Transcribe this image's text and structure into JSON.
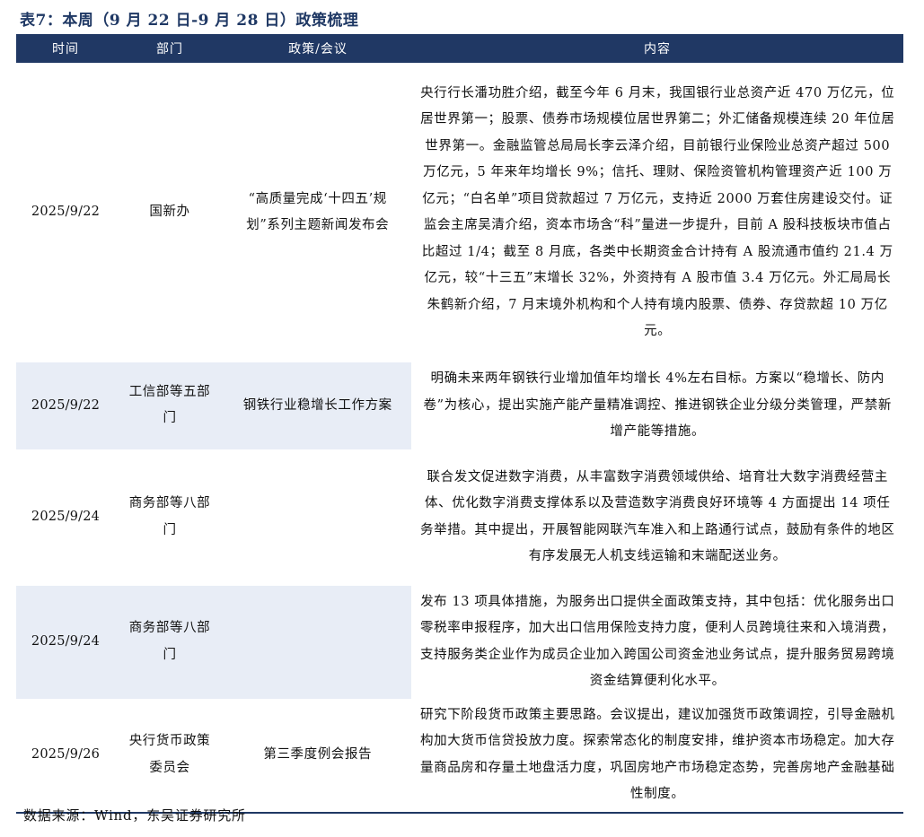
{
  "title": "表7：本周（9 月 22 日-9 月 28 日）政策梳理",
  "headers": {
    "time": "时间",
    "dept": "部门",
    "policy": "政策/会议",
    "content": "内容"
  },
  "rows": [
    {
      "date": "2025/9/22",
      "dept": "国新办",
      "policy": "“高质量完成‘十四五’规划”系列主题新闻发布会",
      "content": "央行行长潘功胜介绍，截至今年 6 月末，我国银行业总资产近 470 万亿元，位居世界第一；股票、债券市场规模位居世界第二；外汇储备规模连续 20 年位居世界第一。金融监管总局局长李云泽介绍，目前银行业保险业总资产超过 500 万亿元，5 年来年均增长 9%；信托、理财、保险资管机构管理资产近 100 万亿元；“白名单”项目贷款超过 7 万亿元，支持近 2000 万套住房建设交付。证监会主席吴清介绍，资本市场含“科”量进一步提升，目前 A 股科技板块市值占比超过 1/4；截至 8 月底，各类中长期资金合计持有 A 股流通市值约 21.4 万亿元，较“十三五”末增长 32%，外资持有 A 股市值 3.4 万亿元。外汇局局长朱鹤新介绍，7 月末境外机构和个人持有境内股票、债券、存贷款超 10 万亿元。"
    },
    {
      "date": "2025/9/22",
      "dept": "工信部等五部门",
      "policy": "钢铁行业稳增长工作方案",
      "content": "明确未来两年钢铁行业增加值年均增长 4%左右目标。方案以“稳增长、防内卷”为核心，提出实施产能产量精准调控、推进钢铁企业分级分类管理，严禁新增产能等措施。"
    },
    {
      "date": "2025/9/24",
      "dept": "商务部等八部门",
      "policy": "",
      "content": "联合发文促进数字消费，从丰富数字消费领域供给、培育壮大数字消费经营主体、优化数字消费支撑体系以及营造数字消费良好环境等 4 方面提出 14 项任务举措。其中提出，开展智能网联汽车准入和上路通行试点，鼓励有条件的地区有序发展无人机支线运输和末端配送业务。"
    },
    {
      "date": "2025/9/24",
      "dept": "商务部等八部门",
      "policy": "",
      "content": "发布 13 项具体措施，为服务出口提供全面政策支持，其中包括：优化服务出口零税率申报程序，加大出口信用保险支持力度，便利人员跨境往来和入境消费，支持服务类企业作为成员企业加入跨国公司资金池业务试点，提升服务贸易跨境资金结算便利化水平。"
    },
    {
      "date": "2025/9/26",
      "dept": "央行货币政策委员会",
      "policy": "第三季度例会报告",
      "content": "研究下阶段货币政策主要思路。会议提出，建议加强货币政策调控，引导金融机构加大货币信贷投放力度。探索常态化的制度安排，维护资本市场稳定。加大存量商品房和存量土地盘活力度，巩固房地产市场稳定态势，完善房地产金融基础性制度。"
    }
  ],
  "source": "数据来源：Wind，东吴证券研究所",
  "colors": {
    "header_bg": "#203864",
    "title": "#1f3864",
    "shade": "#e8edf6"
  }
}
